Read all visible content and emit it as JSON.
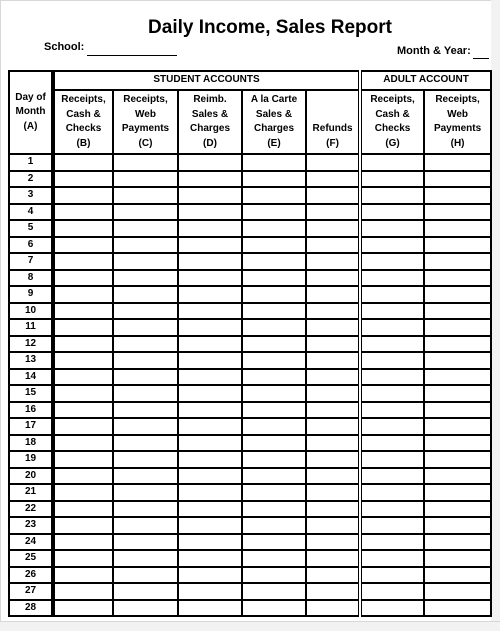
{
  "report": {
    "title": "Daily Income, Sales Report",
    "school_label": "School:",
    "month_year_label": "Month & Year:"
  },
  "table": {
    "groups": {
      "student": "STUDENT ACCOUNTS",
      "adult": "ADULT ACCOUNT"
    },
    "columns": [
      {
        "lines": [
          "Day of",
          "Month",
          "(A)"
        ]
      },
      {
        "lines": [
          "Receipts,",
          "Cash &",
          "Checks",
          "(B)"
        ]
      },
      {
        "lines": [
          "Receipts,",
          "Web",
          "Payments",
          "(C)"
        ]
      },
      {
        "lines": [
          "Reimb.",
          "Sales &",
          "Charges",
          "(D)"
        ]
      },
      {
        "lines": [
          "A la Carte",
          "Sales &",
          "Charges",
          "(E)"
        ]
      },
      {
        "lines": [
          "Refunds",
          "(F)"
        ]
      },
      {
        "lines": [
          "Receipts,",
          "Cash &",
          "Checks",
          "(G)"
        ]
      },
      {
        "lines": [
          "Receipts,",
          "Web",
          "Payments",
          "(H)"
        ]
      }
    ],
    "days": [
      "1",
      "2",
      "3",
      "4",
      "5",
      "6",
      "7",
      "8",
      "9",
      "10",
      "11",
      "12",
      "13",
      "14",
      "15",
      "16",
      "17",
      "18",
      "19",
      "20",
      "21",
      "22",
      "23",
      "24",
      "25",
      "26",
      "27",
      "28"
    ]
  }
}
